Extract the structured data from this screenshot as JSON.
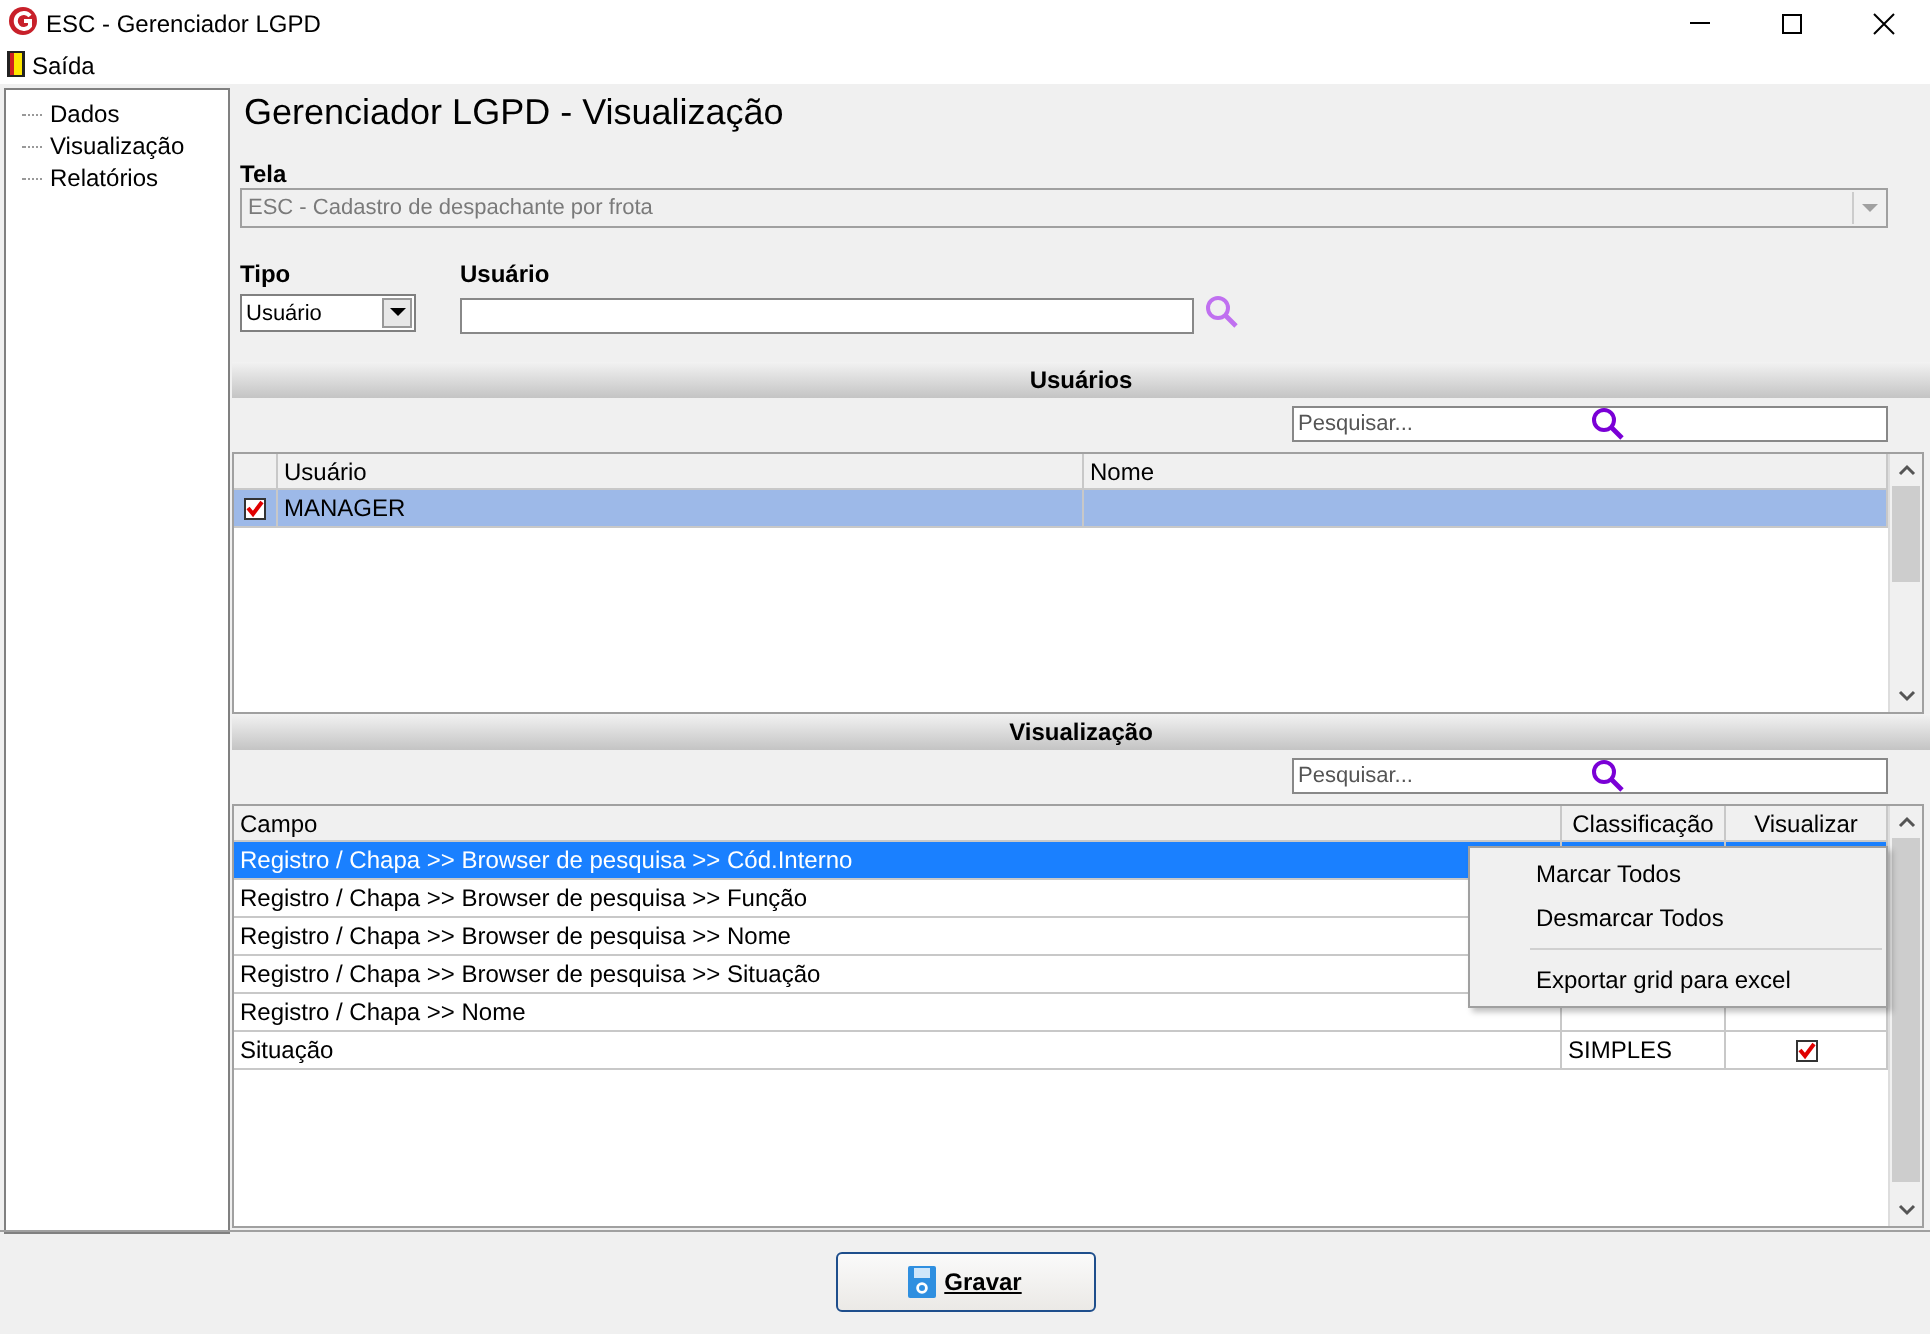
{
  "window": {
    "title": "ESC - Gerenciador LGPD"
  },
  "menu": [
    "Saída"
  ],
  "sidebar": {
    "items": [
      {
        "label": "Dados"
      },
      {
        "label": "Visualização"
      },
      {
        "label": "Relatórios"
      }
    ]
  },
  "heading": "Gerenciador LGPD - Visualização",
  "tela": {
    "label": "Tela",
    "value": "ESC - Cadastro de despachante por frota",
    "disabled": true
  },
  "tipo": {
    "label": "Tipo",
    "value": "Usuário"
  },
  "usuario": {
    "label": "Usuário"
  },
  "users_section": {
    "title": "Usuários",
    "search": {
      "placeholder": "Pesquisar..."
    },
    "columns": [
      "Usuário",
      "Nome"
    ],
    "rows": [
      {
        "usuario": "MANAGER",
        "checked": true,
        "selected": true
      }
    ]
  },
  "view_section": {
    "title": "Visualização",
    "search": {
      "placeholder": "Pesquisar..."
    },
    "columns": [
      "Campo",
      "Classificação",
      "Visualizar"
    ],
    "rows": [
      {
        "campo": "Registro / Chapa >> Browser de pesquisa >> Cód.Interno",
        "selected": true
      },
      {
        "campo": "Registro / Chapa >> Browser de pesquisa >> Função",
        "selected": false
      },
      {
        "campo": "Registro / Chapa >> Browser de pesquisa >> Nome",
        "selected": false
      },
      {
        "campo": "Registro / Chapa >> Browser de pesquisa >> Situação",
        "selected": false
      },
      {
        "campo": "Registro / Chapa >> Nome",
        "selected": false
      },
      {
        "campo": "Situação",
        "classificacao": "SIMPLES",
        "checked": true,
        "selected": false
      }
    ]
  },
  "context_menu": {
    "items": [
      {
        "label": "Marcar Todos",
        "kind": "item"
      },
      {
        "label": "Desmarcar Todos",
        "kind": "item"
      },
      {
        "kind": "separator"
      },
      {
        "label": "Exportar grid para excel",
        "kind": "item"
      }
    ]
  },
  "save_button": {
    "label": "Gravar"
  }
}
